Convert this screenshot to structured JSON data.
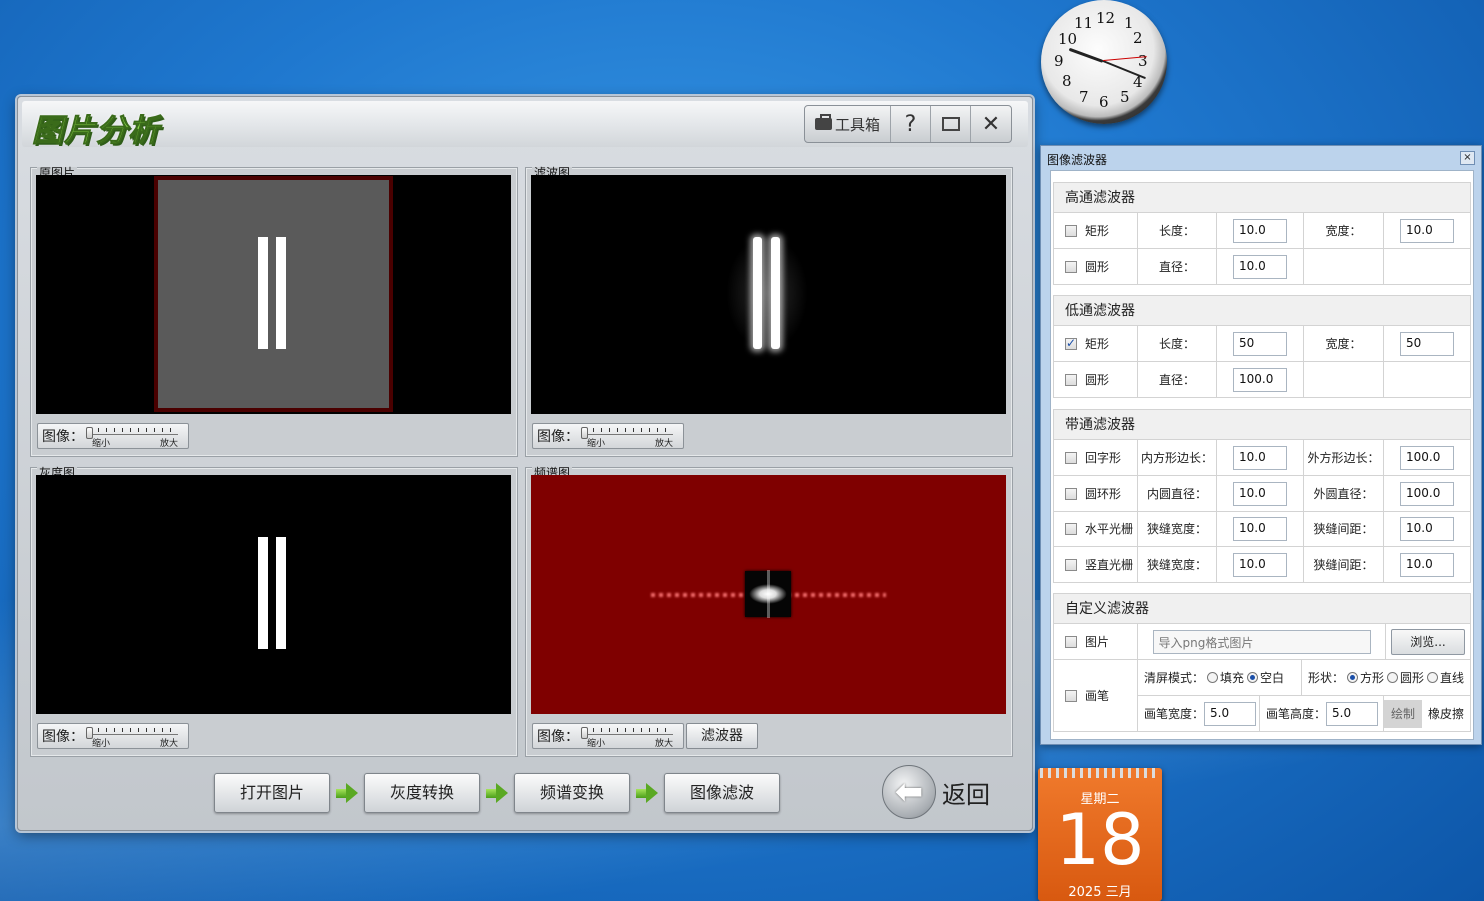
{
  "app": {
    "title": "图片分析",
    "toolbox_label": "工具箱",
    "help_label": "?",
    "restore_label": "▭",
    "close_label": "✕"
  },
  "panels": {
    "original": {
      "label": "原图片"
    },
    "filtered": {
      "label": "滤波图"
    },
    "grayscale": {
      "label": "灰度图"
    },
    "spectrum": {
      "label": "频谱图"
    }
  },
  "zoom": {
    "label": "图像：",
    "min": "缩小",
    "max": "放大"
  },
  "spectrum_filter_button": "滤波器",
  "flow": {
    "open": "打开图片",
    "gray": "灰度转换",
    "spectrum": "频谱变换",
    "filter": "图像滤波"
  },
  "back_label": "返回",
  "filter_dialog": {
    "title": "图像滤波器",
    "close": "×",
    "highpass": {
      "header": "高通滤波器",
      "rect_label": "矩形",
      "rect_checked": false,
      "length_label": "长度：",
      "length": "10.0",
      "width_label": "宽度：",
      "width": "10.0",
      "circle_label": "圆形",
      "circle_checked": false,
      "diameter_label": "直径：",
      "diameter": "10.0"
    },
    "lowpass": {
      "header": "低通滤波器",
      "rect_label": "矩形",
      "rect_checked": true,
      "length_label": "长度：",
      "length": "50",
      "width_label": "宽度：",
      "width": "50",
      "circle_label": "圆形",
      "circle_checked": false,
      "diameter_label": "直径：",
      "diameter": "100.0"
    },
    "bandpass": {
      "header": "带通滤波器",
      "hui_label": "回字形",
      "inner_side_label": "内方形边长：",
      "inner_side": "10.0",
      "outer_side_label": "外方形边长：",
      "outer_side": "100.0",
      "ring_label": "圆环形",
      "inner_d_label": "内圆直径：",
      "inner_d": "10.0",
      "outer_d_label": "外圆直径：",
      "outer_d": "100.0",
      "hgrating_label": "水平光栅",
      "h_slit_w_label": "狭缝宽度：",
      "h_slit_w": "10.0",
      "h_slit_gap_label": "狭缝间距：",
      "h_slit_gap": "10.0",
      "vgrating_label": "竖直光栅",
      "v_slit_w_label": "狭缝宽度：",
      "v_slit_w": "10.0",
      "v_slit_gap_label": "狭缝间距：",
      "v_slit_gap": "10.0"
    },
    "custom": {
      "header": "自定义滤波器",
      "image_label": "图片",
      "image_placeholder": "导入png格式图片",
      "browse": "浏览...",
      "pen_label": "画笔",
      "clear_mode_label": "清屏模式：",
      "fill": "填充",
      "blank": "空白",
      "shape_label": "形状：",
      "square": "方形",
      "circle": "圆形",
      "line": "直线",
      "pen_w_label": "画笔宽度：",
      "pen_w": "5.0",
      "pen_h_label": "画笔高度：",
      "pen_h": "5.0",
      "draw": "绘制",
      "eraser": "橡皮擦"
    }
  },
  "clock": {
    "numbers": [
      "12",
      "1",
      "2",
      "3",
      "4",
      "5",
      "6",
      "7",
      "8",
      "9",
      "10",
      "11"
    ]
  },
  "calendar": {
    "weekday": "星期二",
    "day": "18",
    "month": "2025 三月"
  }
}
